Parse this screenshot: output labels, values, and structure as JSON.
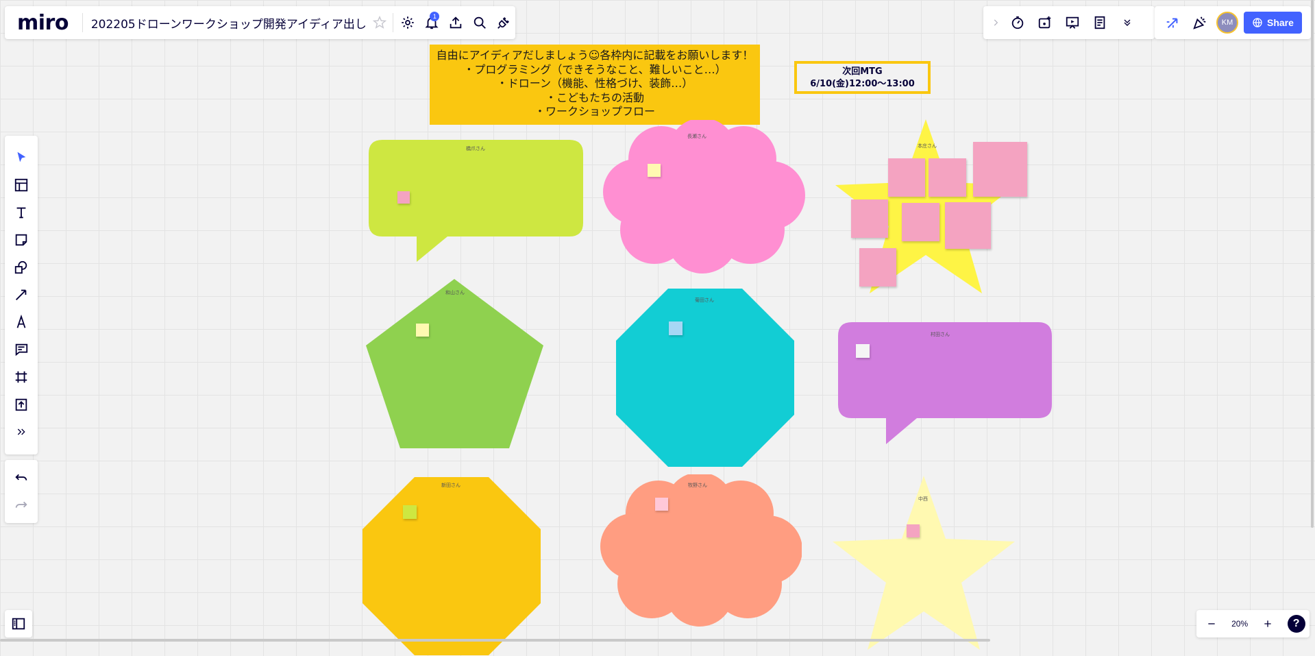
{
  "app": {
    "logo": "miro",
    "board_title": "202205ドローンワークショップ開発アイディア出し",
    "notification_count": "1",
    "user_initials": "KM",
    "share_label": "Share"
  },
  "zoom": {
    "level": "20%"
  },
  "canvas": {
    "banner_lines": [
      "自由にアイディアだしましょう☺各枠内に記載をお願いします！",
      "・プログラミング（できそうなこと、難しいこと…）",
      "・ドローン（機能、性格づけ、装飾…）",
      "・こどもたちの活動",
      "・ワークショップフロー"
    ],
    "next_meeting": {
      "title": "次回MTG",
      "time": "6/10(金)12:00～13:00"
    },
    "shape_labels": {
      "bubble_green": "橋爪さん",
      "cloud_pink": "長瀬さん",
      "star_yellow": "本庄さん",
      "pentagon_green": "和山さん",
      "octagon_teal": "菊田さん",
      "bubble_purple": "村田さん",
      "octagon_orange": "新田さん",
      "cloud_salmon": "牧野さん",
      "star_light": "中西"
    }
  },
  "colors": {
    "accent": "#4262ff",
    "banner": "#fac710",
    "lime": "#cee741",
    "pink": "#ff8fd2",
    "yellow": "#fef445",
    "green": "#8fd14f",
    "teal": "#12cdd4",
    "purple": "#d17dde",
    "orange": "#fac710",
    "salmon": "#ff9d81",
    "light_yellow": "#fff9b1"
  }
}
